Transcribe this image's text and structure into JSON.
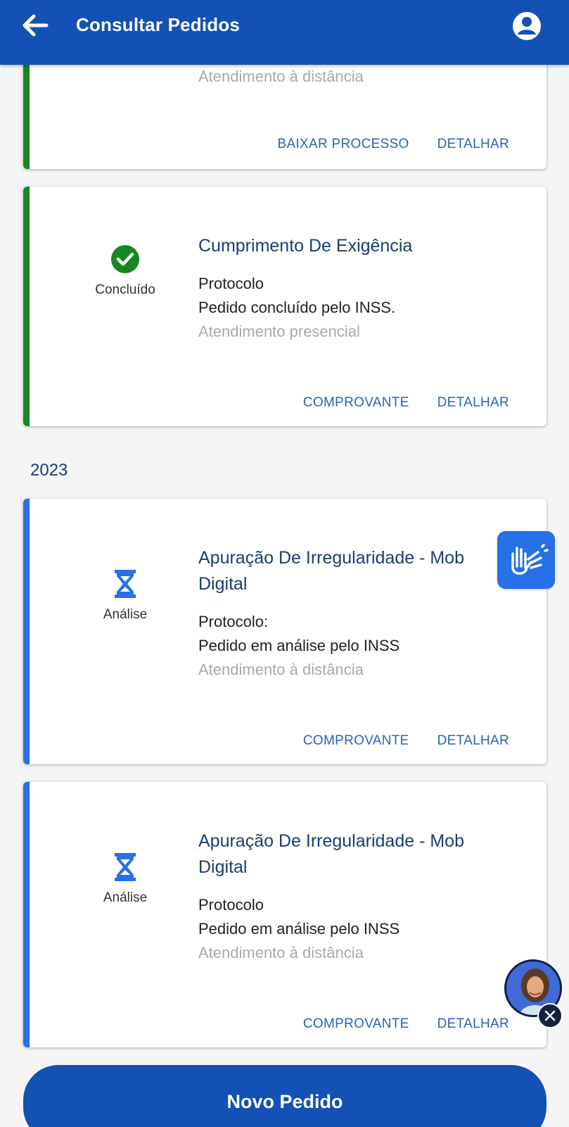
{
  "header": {
    "title": "Consultar Pedidos",
    "back_icon": "arrow-left-icon",
    "user_icon": "user-circle-icon"
  },
  "cards": [
    {
      "status_label": "",
      "title": "",
      "protocol": "",
      "status_text": "",
      "service": "Atendimento à distância",
      "actions": [
        "BAIXAR PROCESSO",
        "DETALHAR"
      ]
    },
    {
      "status_label": "Concluído",
      "status_icon": "check-circle-icon",
      "title": "Cumprimento De Exigência",
      "protocol": "Protocolo",
      "status_text": "Pedido concluído pelo INSS.",
      "service": "Atendimento presencial",
      "actions": [
        "COMPROVANTE",
        "DETALHAR"
      ]
    },
    {
      "status_label": "Análise",
      "status_icon": "hourglass-icon",
      "title": "Apuração De Irregularidade - Mob Digital",
      "protocol": "Protocolo:",
      "status_text": "Pedido em análise pelo INSS",
      "service": "Atendimento à distância",
      "actions": [
        "COMPROVANTE",
        "DETALHAR"
      ]
    },
    {
      "status_label": "Análise",
      "status_icon": "hourglass-icon",
      "title": "Apuração De Irregularidade - Mob Digital",
      "protocol": "Protocolo",
      "status_text": "Pedido em análise pelo INSS",
      "service": "Atendimento à distância",
      "actions": [
        "COMPROVANTE",
        "DETALHAR"
      ]
    }
  ],
  "year_label": "2023",
  "floating": {
    "libras_icon": "sign-language-icon",
    "assistant_icon": "assistant-avatar-icon",
    "close_icon": "close-icon"
  },
  "cta": {
    "label": "Novo Pedido"
  },
  "colors": {
    "primary": "#1351b4",
    "success": "#168821",
    "pending": "#2670e8",
    "link": "#2a63b8"
  }
}
